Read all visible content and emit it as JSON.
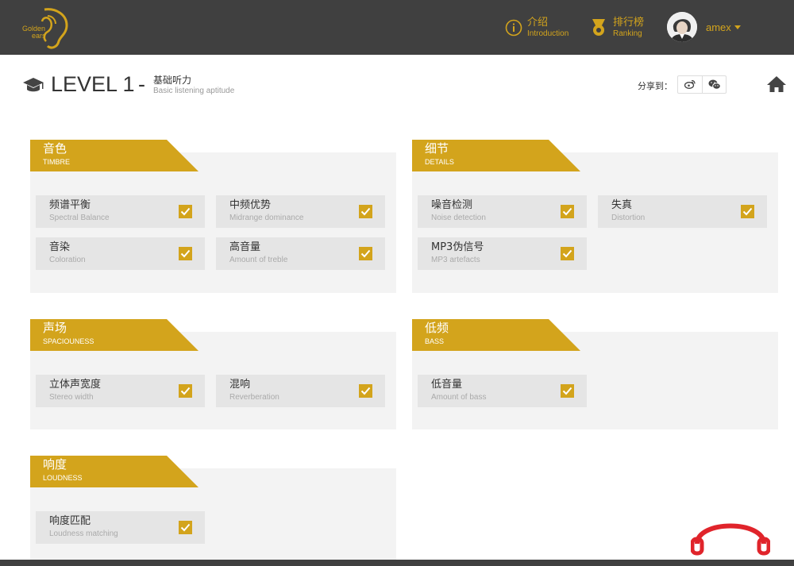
{
  "header": {
    "logo_line1": "Golden",
    "logo_line2": "ears",
    "nav": [
      {
        "cn": "介绍",
        "en": "Introduction",
        "icon": "info-icon"
      },
      {
        "cn": "排行榜",
        "en": "Ranking",
        "icon": "medal-icon"
      }
    ],
    "username": "amex"
  },
  "level": {
    "title": "LEVEL 1",
    "dash": "-",
    "subtitle_cn": "基础听力",
    "subtitle_en": "Basic listening aptitude"
  },
  "share": {
    "label": "分享到："
  },
  "colors": {
    "accent": "#d3a41c",
    "topbar": "#404040",
    "panel": "#f3f3f3",
    "item": "#e5e5e5"
  },
  "sections": [
    {
      "cn": "音色",
      "en": "TIMBRE",
      "items": [
        {
          "cn": "频谱平衡",
          "en": "Spectral Balance",
          "checked": true
        },
        {
          "cn": "中频优势",
          "en": "Midrange dominance",
          "checked": true
        },
        {
          "cn": "音染",
          "en": "Coloration",
          "checked": true
        },
        {
          "cn": "高音量",
          "en": "Amount of treble",
          "checked": true
        }
      ]
    },
    {
      "cn": "细节",
      "en": "DETAILS",
      "items": [
        {
          "cn": "噪音检测",
          "en": "Noise detection",
          "checked": true
        },
        {
          "cn": "失真",
          "en": "Distortion",
          "checked": true
        },
        {
          "cn": "MP3伪信号",
          "en": "MP3 artefacts",
          "checked": true
        }
      ]
    },
    {
      "cn": "声场",
      "en": "SPACIOUNESS",
      "items": [
        {
          "cn": "立体声宽度",
          "en": "Stereo width",
          "checked": true
        },
        {
          "cn": "混响",
          "en": "Reverberation",
          "checked": true
        }
      ]
    },
    {
      "cn": "低频",
      "en": "BASS",
      "items": [
        {
          "cn": "低音量",
          "en": "Amount of bass",
          "checked": true
        }
      ]
    },
    {
      "cn": "响度",
      "en": "LOUDNESS",
      "items": [
        {
          "cn": "响度匹配",
          "en": "Loudness matching",
          "checked": true
        }
      ]
    }
  ]
}
